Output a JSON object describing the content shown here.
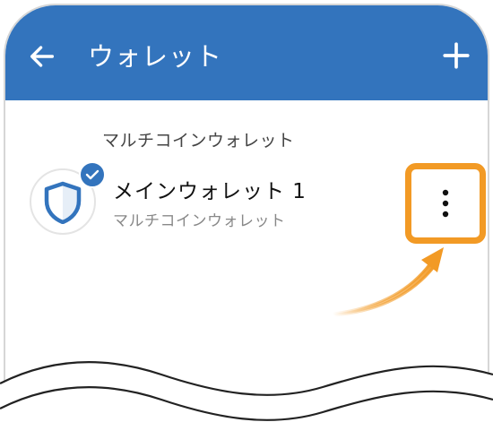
{
  "app_bar": {
    "title": "ウォレット",
    "back_icon": "arrow-left-icon",
    "add_icon": "plus-icon",
    "color": "#3374bd"
  },
  "section": {
    "header": "マルチコインウォレット"
  },
  "wallet": {
    "name": "メインウォレット 1",
    "type": "マルチコインウォレット",
    "avatar_icon": "shield-icon",
    "selected_badge_icon": "check-icon",
    "more_icon": "more-vert-icon"
  },
  "highlight": {
    "color": "#f29a25"
  }
}
